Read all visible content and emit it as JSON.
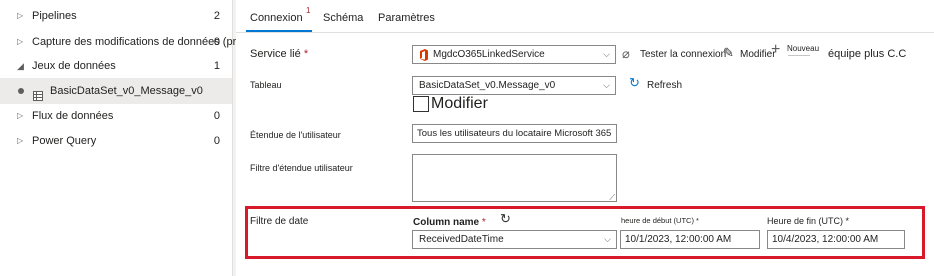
{
  "sidebar": {
    "items": [
      {
        "label": "Pipelines",
        "count": "2"
      },
      {
        "label": "Capture des modifications de données (préversion)",
        "count": "0"
      },
      {
        "label": "Jeux de données",
        "count": "1"
      },
      {
        "label": "BasicDataSet_v0_Message_v0"
      },
      {
        "label": "Flux de données",
        "count": "0"
      },
      {
        "label": "Power Query",
        "count": "0"
      }
    ]
  },
  "tabs": {
    "connexion": "Connexion",
    "connexion_badge": "1",
    "schema": "Schéma",
    "parametres": "Paramètres"
  },
  "form": {
    "linked_service_label": "Service lié",
    "required_mark": "*",
    "linked_service_value": "MgdcO365LinkedService",
    "test_connection": "Tester la connexion",
    "edit": "Modifier",
    "new": "Nouveau",
    "extra_text": "équipe plus C.C",
    "table_label": "Tableau",
    "table_value": "BasicDataSet_v0.Message_v0",
    "refresh": "Refresh",
    "edit_checkbox": "Modifier",
    "user_scope_label": "Étendue de l'utilisateur",
    "user_scope_value": "Tous les utilisateurs du locataire Microsoft 365",
    "user_scope_filter_label": "Filtre d'étendue utilisateur",
    "date_filter_label": "Filtre de date",
    "column_name_label": "Column name",
    "column_name_value": "ReceivedDateTime",
    "start_time_label": "heure de début (UTC)",
    "start_time_value": "10/1/2023, 12:00:00 AM",
    "end_time_label": "Heure de fin (UTC)",
    "end_time_value": "10/4/2023, 12:00:00 AM"
  },
  "colors": {
    "accent": "#0078d4",
    "required": "#a4262c",
    "highlight_border": "#d7192a",
    "office_red": "#d83b01"
  }
}
